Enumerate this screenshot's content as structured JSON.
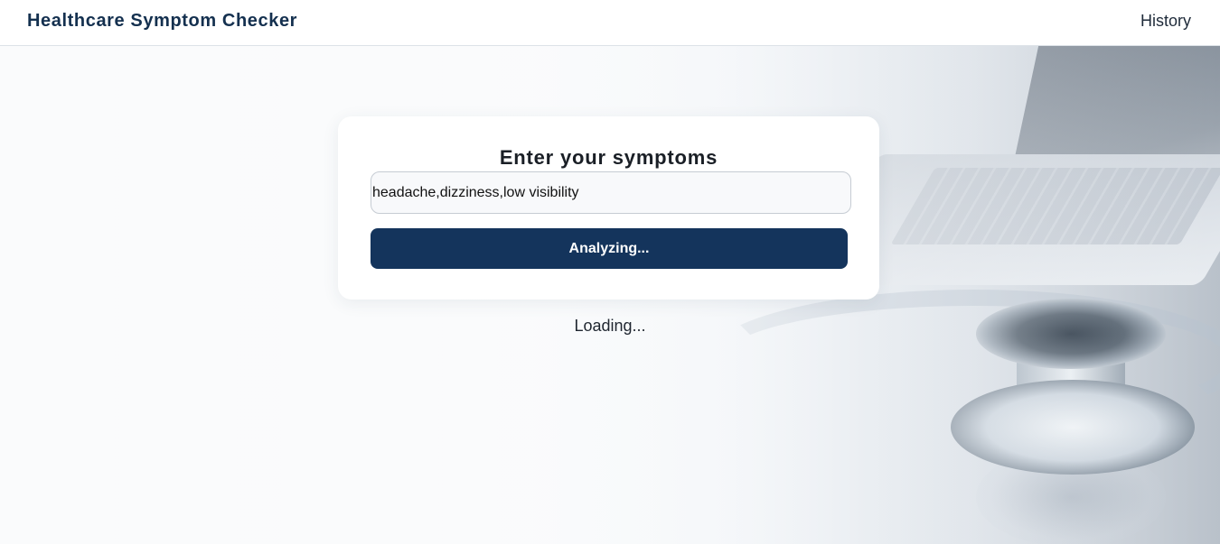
{
  "navbar": {
    "brand": "Healthcare Symptom Checker",
    "history_link": "History"
  },
  "symptom_form": {
    "title": "Enter your symptoms",
    "input_value": "headache,dizziness,low visibility",
    "button_label": "Analyzing..."
  },
  "status": {
    "loading_text": "Loading..."
  },
  "colors": {
    "brand": "#14304f",
    "button": "#14345c",
    "card_background": "#ffffff"
  }
}
